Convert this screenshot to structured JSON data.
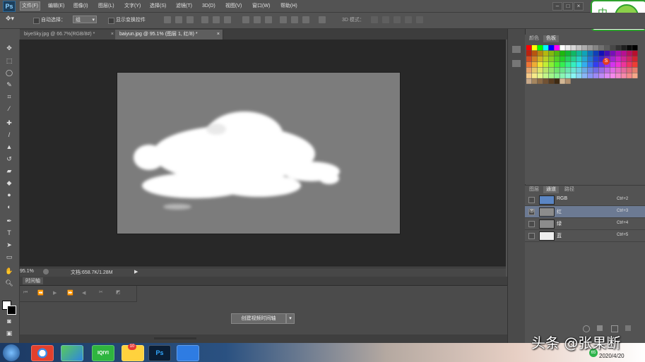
{
  "app": {
    "logo_text": "Ps"
  },
  "menu": {
    "items": [
      "文件(F)",
      "编辑(E)",
      "图像(I)",
      "图层(L)",
      "文字(Y)",
      "选择(S)",
      "滤镜(T)",
      "3D(D)",
      "视图(V)",
      "窗口(W)",
      "帮助(H)"
    ],
    "active_index": 0
  },
  "options": {
    "auto_select_label": "自动选择：",
    "auto_select_value": "组",
    "show_transform_label": "显示变换控件",
    "mode_3d_label": "3D 模式："
  },
  "tabs": [
    {
      "label": "biyeSky.jpg @ 66.7%(RGB/8#) *",
      "close": "×"
    },
    {
      "label": "baiyun.jpg @ 95.1% (图层 1, 红/8) *",
      "close": "×"
    }
  ],
  "status": {
    "zoom": "95.1%",
    "doc_info": "文档:658.7K/1.28M"
  },
  "timeline": {
    "title": "时间轴",
    "create_button": "创建视频时间轴",
    "dropdown_arrow": "▾"
  },
  "swatch_panel": {
    "tabs": [
      "颜色",
      "色板"
    ],
    "active_tab": 1
  },
  "channel_panel": {
    "tabs": [
      "图层",
      "通道",
      "路径"
    ],
    "active_tab": 1,
    "rows": [
      {
        "name": "RGB",
        "shortcut": "Ctrl+2",
        "eye": ""
      },
      {
        "name": "红",
        "shortcut": "Ctrl+3",
        "eye": "👁"
      },
      {
        "name": "绿",
        "shortcut": "Ctrl+4",
        "eye": ""
      },
      {
        "name": "蓝",
        "shortcut": "Ctrl+5",
        "eye": ""
      }
    ],
    "selected_index": 1
  },
  "taskbar": {
    "apps": [
      "",
      "",
      "",
      "IQIYI",
      "",
      "Ps",
      ""
    ],
    "notification_badge": "10",
    "tray_badge": "65",
    "date": "2020/4/20"
  },
  "watermark": "头条 @张果断",
  "ime": {
    "label": "中"
  },
  "colors": {
    "ui_dark": "#535353",
    "canvas_bg": "#282828",
    "doc_bg": "#7c7c7c",
    "selection": "#6c7a93"
  }
}
